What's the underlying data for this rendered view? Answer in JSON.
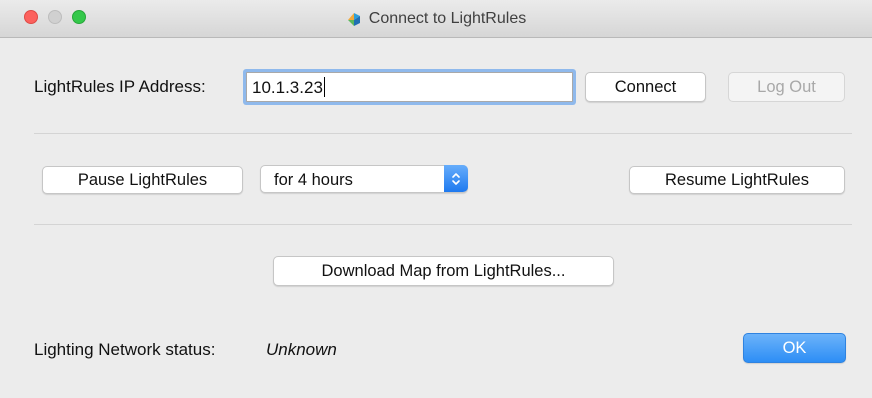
{
  "window": {
    "title": "Connect to LightRules"
  },
  "connection": {
    "ip_label": "LightRules IP Address:",
    "ip_value": "10.1.3.23",
    "connect_label": "Connect",
    "logout_label": "Log Out"
  },
  "pause": {
    "pause_label": "Pause LightRules",
    "duration_value": "for 4 hours",
    "resume_label": "Resume LightRules"
  },
  "download": {
    "label": "Download Map from LightRules..."
  },
  "status": {
    "label": "Lighting Network status:",
    "value": "Unknown"
  },
  "footer": {
    "ok_label": "OK"
  },
  "colors": {
    "accent": "#2d8ef5",
    "window_bg": "#ececec",
    "close": "#fc615d",
    "zoom": "#34c84a"
  },
  "icons": {
    "app": "lightrules-app-icon",
    "stepper": "up-down-chevron-icon"
  }
}
